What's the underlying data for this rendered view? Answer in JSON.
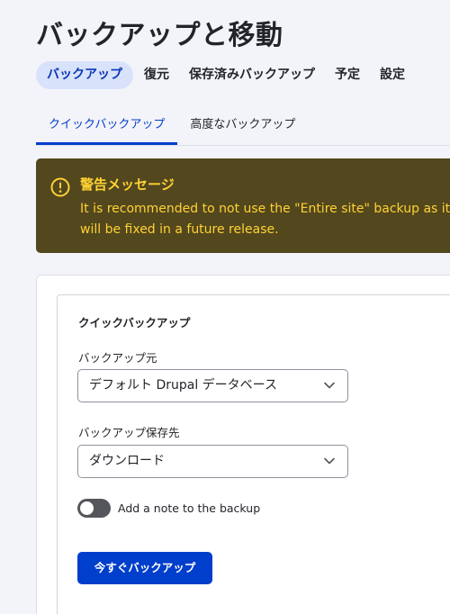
{
  "page": {
    "title": "バックアップと移動"
  },
  "primary_tabs": [
    {
      "label": "バックアップ",
      "active": true
    },
    {
      "label": "復元"
    },
    {
      "label": "保存済みバックアップ"
    },
    {
      "label": "予定"
    },
    {
      "label": "設定"
    }
  ],
  "secondary_tabs": [
    {
      "label": "クイックバックアップ",
      "active": true
    },
    {
      "label": "高度なバックアップ"
    }
  ],
  "warning": {
    "icon": "warning-circle-icon",
    "title": "警告メッセージ",
    "message": "It is recommended to not use the \"Entire site\" backup as it ... will be fixed in a future release.",
    "message_line1": "It is recommended to not use the \"Entire site\" backup as it",
    "message_line2": "will be fixed in a future release.",
    "background_color": "#53471e",
    "text_color": "#ffd233"
  },
  "form": {
    "legend": "クイックバックアップ",
    "source": {
      "label": "バックアップ元",
      "value": "デフォルト Drupal データベース"
    },
    "destination": {
      "label": "バックアップ保存先",
      "value": "ダウンロード"
    },
    "note_toggle": {
      "label": "Add a note to the backup",
      "checked": false
    },
    "submit_label": "今すぐバックアップ"
  },
  "colors": {
    "accent": "#003ecc",
    "active_tab_bg": "#d9e2fb",
    "page_bg": "#f3f4f9"
  }
}
